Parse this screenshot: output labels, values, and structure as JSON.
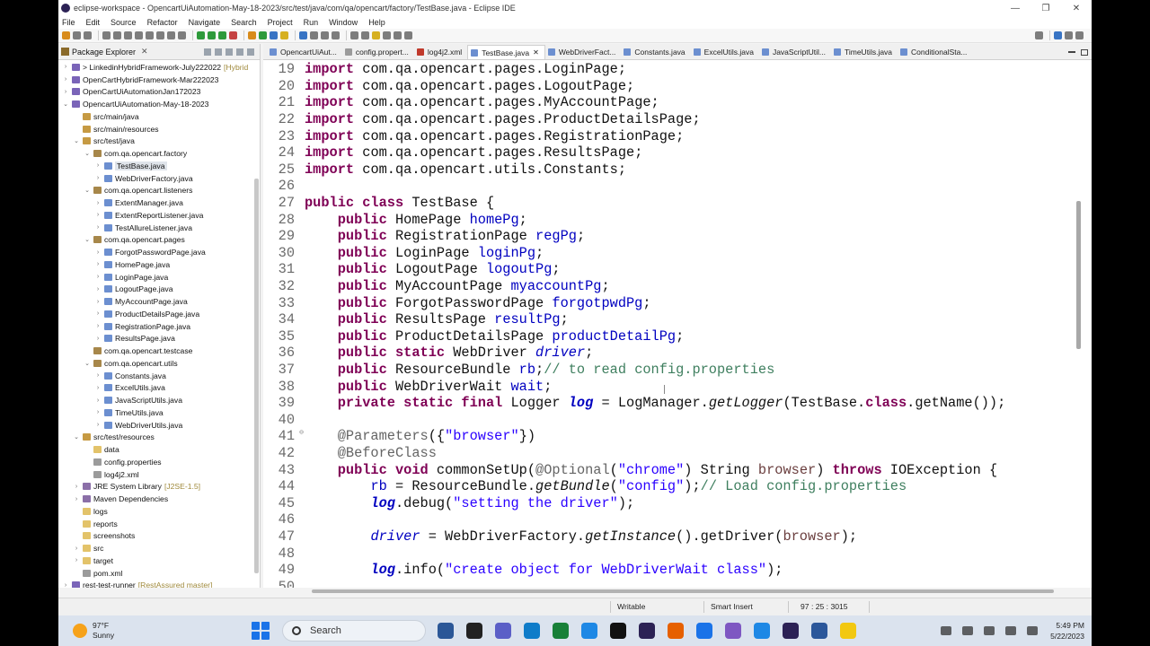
{
  "window": {
    "title": "eclipse-workspace - OpencartUiAutomation-May-18-2023/src/test/java/com/qa/opencart/factory/TestBase.java - Eclipse IDE",
    "buttons": {
      "minimize": "—",
      "maximize": "❐",
      "close": "✕"
    }
  },
  "menu": [
    "File",
    "Edit",
    "Source",
    "Refactor",
    "Navigate",
    "Search",
    "Project",
    "Run",
    "Window",
    "Help"
  ],
  "explorer": {
    "title": "Package Explorer",
    "rows": [
      {
        "label": "> LinkedinHybridFramework-July222022",
        "deco": "[Hybrid",
        "level": 0,
        "icon": "proj",
        "tw": "›"
      },
      {
        "label": "OpenCartHybridFramework-Mar222023",
        "deco": "",
        "level": 0,
        "icon": "proj",
        "tw": "›"
      },
      {
        "label": "OpenCartUiAutomationJan172023",
        "deco": "",
        "level": 0,
        "icon": "proj",
        "tw": "›"
      },
      {
        "label": "OpencartUiAutomation-May-18-2023",
        "deco": "",
        "level": 0,
        "icon": "proj",
        "tw": "⌄"
      },
      {
        "label": "src/main/java",
        "deco": "",
        "level": 1,
        "icon": "src",
        "tw": ""
      },
      {
        "label": "src/main/resources",
        "deco": "",
        "level": 1,
        "icon": "src",
        "tw": ""
      },
      {
        "label": "src/test/java",
        "deco": "",
        "level": 1,
        "icon": "src",
        "tw": "⌄"
      },
      {
        "label": "com.qa.opencart.factory",
        "deco": "",
        "level": 2,
        "icon": "pkg",
        "tw": "⌄"
      },
      {
        "label": "TestBase.java",
        "deco": "",
        "level": 3,
        "icon": "java",
        "tw": "›",
        "sel": true
      },
      {
        "label": "WebDriverFactory.java",
        "deco": "",
        "level": 3,
        "icon": "java",
        "tw": "›"
      },
      {
        "label": "com.qa.opencart.listeners",
        "deco": "",
        "level": 2,
        "icon": "pkg",
        "tw": "⌄"
      },
      {
        "label": "ExtentManager.java",
        "deco": "",
        "level": 3,
        "icon": "java",
        "tw": "›"
      },
      {
        "label": "ExtentReportListener.java",
        "deco": "",
        "level": 3,
        "icon": "java",
        "tw": "›"
      },
      {
        "label": "TestAllureListener.java",
        "deco": "",
        "level": 3,
        "icon": "java",
        "tw": "›"
      },
      {
        "label": "com.qa.opencart.pages",
        "deco": "",
        "level": 2,
        "icon": "pkg",
        "tw": "⌄"
      },
      {
        "label": "ForgotPasswordPage.java",
        "deco": "",
        "level": 3,
        "icon": "java",
        "tw": "›"
      },
      {
        "label": "HomePage.java",
        "deco": "",
        "level": 3,
        "icon": "java",
        "tw": "›"
      },
      {
        "label": "LoginPage.java",
        "deco": "",
        "level": 3,
        "icon": "java",
        "tw": "›"
      },
      {
        "label": "LogoutPage.java",
        "deco": "",
        "level": 3,
        "icon": "java",
        "tw": "›"
      },
      {
        "label": "MyAccountPage.java",
        "deco": "",
        "level": 3,
        "icon": "java",
        "tw": "›"
      },
      {
        "label": "ProductDetailsPage.java",
        "deco": "",
        "level": 3,
        "icon": "java",
        "tw": "›"
      },
      {
        "label": "RegistrationPage.java",
        "deco": "",
        "level": 3,
        "icon": "java",
        "tw": "›"
      },
      {
        "label": "ResultsPage.java",
        "deco": "",
        "level": 3,
        "icon": "java",
        "tw": "›"
      },
      {
        "label": "com.qa.opencart.testcase",
        "deco": "",
        "level": 2,
        "icon": "pkg",
        "tw": ""
      },
      {
        "label": "com.qa.opencart.utils",
        "deco": "",
        "level": 2,
        "icon": "pkg",
        "tw": "⌄"
      },
      {
        "label": "Constants.java",
        "deco": "",
        "level": 3,
        "icon": "java",
        "tw": "›"
      },
      {
        "label": "ExcelUtils.java",
        "deco": "",
        "level": 3,
        "icon": "java",
        "tw": "›"
      },
      {
        "label": "JavaScriptUtils.java",
        "deco": "",
        "level": 3,
        "icon": "java",
        "tw": "›"
      },
      {
        "label": "TimeUtils.java",
        "deco": "",
        "level": 3,
        "icon": "java",
        "tw": "›"
      },
      {
        "label": "WebDriverUtils.java",
        "deco": "",
        "level": 3,
        "icon": "java",
        "tw": "›"
      },
      {
        "label": "src/test/resources",
        "deco": "",
        "level": 1,
        "icon": "src",
        "tw": "⌄"
      },
      {
        "label": "data",
        "deco": "",
        "level": 2,
        "icon": "folder",
        "tw": ""
      },
      {
        "label": "config.properties",
        "deco": "",
        "level": 2,
        "icon": "file",
        "tw": ""
      },
      {
        "label": "log4j2.xml",
        "deco": "",
        "level": 2,
        "icon": "file",
        "tw": ""
      },
      {
        "label": "JRE System Library",
        "deco": "[J2SE-1.5]",
        "level": 1,
        "icon": "lib",
        "tw": "›"
      },
      {
        "label": "Maven Dependencies",
        "deco": "",
        "level": 1,
        "icon": "lib",
        "tw": "›"
      },
      {
        "label": "logs",
        "deco": "",
        "level": 1,
        "icon": "folder",
        "tw": ""
      },
      {
        "label": "reports",
        "deco": "",
        "level": 1,
        "icon": "folder",
        "tw": ""
      },
      {
        "label": "screenshots",
        "deco": "",
        "level": 1,
        "icon": "folder",
        "tw": ""
      },
      {
        "label": "src",
        "deco": "",
        "level": 1,
        "icon": "folder",
        "tw": "›"
      },
      {
        "label": "target",
        "deco": "",
        "level": 1,
        "icon": "folder",
        "tw": "›"
      },
      {
        "label": "pom.xml",
        "deco": "",
        "level": 1,
        "icon": "file",
        "tw": ""
      },
      {
        "label": "rest-test-runner",
        "deco": "[RestAssured master]",
        "level": 0,
        "icon": "proj",
        "tw": "›"
      }
    ]
  },
  "tabs": [
    {
      "label": "OpencartUiAut...",
      "icon": "j",
      "active": false
    },
    {
      "label": "config.propert...",
      "icon": "f",
      "active": false
    },
    {
      "label": "log4j2.xml",
      "icon": "x",
      "active": false
    },
    {
      "label": "TestBase.java",
      "icon": "j",
      "active": true
    },
    {
      "label": "WebDriverFact...",
      "icon": "j",
      "active": false
    },
    {
      "label": "Constants.java",
      "icon": "j",
      "active": false
    },
    {
      "label": "ExcelUtils.java",
      "icon": "j",
      "active": false
    },
    {
      "label": "JavaScriptUtil...",
      "icon": "j",
      "active": false
    },
    {
      "label": "TimeUtils.java",
      "icon": "j",
      "active": false
    },
    {
      "label": "ConditionalSta...",
      "icon": "j",
      "active": false
    }
  ],
  "code": [
    {
      "n": "19",
      "t": [
        [
          "kw",
          "import"
        ],
        [
          "",
          "com.qa.opencart.pages.LoginPage;"
        ]
      ]
    },
    {
      "n": "20",
      "t": [
        [
          "kw",
          "import"
        ],
        [
          "",
          "com.qa.opencart.pages.LogoutPage;"
        ]
      ]
    },
    {
      "n": "21",
      "t": [
        [
          "kw",
          "import"
        ],
        [
          "",
          "com.qa.opencart.pages.MyAccountPage;"
        ]
      ]
    },
    {
      "n": "22",
      "t": [
        [
          "kw",
          "import"
        ],
        [
          "",
          "com.qa.opencart.pages.ProductDetailsPage;"
        ]
      ]
    },
    {
      "n": "23",
      "t": [
        [
          "kw",
          "import"
        ],
        [
          "",
          "com.qa.opencart.pages.RegistrationPage;"
        ]
      ]
    },
    {
      "n": "24",
      "t": [
        [
          "kw",
          "import"
        ],
        [
          "",
          "com.qa.opencart.pages.ResultsPage;"
        ]
      ]
    },
    {
      "n": "25",
      "t": [
        [
          "kw",
          "import"
        ],
        [
          "",
          "com.qa.opencart.utils.Constants;"
        ]
      ]
    },
    {
      "n": "26",
      "t": []
    },
    {
      "n": "27",
      "t": [
        [
          "kw",
          "public class"
        ],
        [
          "",
          " TestBase {"
        ]
      ]
    },
    {
      "n": "28",
      "t": [
        [
          "",
          "    "
        ],
        [
          "kw",
          "public"
        ],
        [
          "",
          " HomePage "
        ],
        [
          "fld",
          "homePg"
        ],
        [
          "",
          ";"
        ]
      ]
    },
    {
      "n": "29",
      "t": [
        [
          "",
          "    "
        ],
        [
          "kw",
          "public"
        ],
        [
          "",
          " RegistrationPage "
        ],
        [
          "fld",
          "regPg"
        ],
        [
          "",
          ";"
        ]
      ]
    },
    {
      "n": "30",
      "t": [
        [
          "",
          "    "
        ],
        [
          "kw",
          "public"
        ],
        [
          "",
          " LoginPage "
        ],
        [
          "fld",
          "loginPg"
        ],
        [
          "",
          ";"
        ]
      ]
    },
    {
      "n": "31",
      "t": [
        [
          "",
          "    "
        ],
        [
          "kw",
          "public"
        ],
        [
          "",
          " LogoutPage "
        ],
        [
          "fld",
          "logoutPg"
        ],
        [
          "",
          ";"
        ]
      ]
    },
    {
      "n": "32",
      "t": [
        [
          "",
          "    "
        ],
        [
          "kw",
          "public"
        ],
        [
          "",
          " MyAccountPage "
        ],
        [
          "fld",
          "myaccountPg"
        ],
        [
          "",
          ";"
        ]
      ]
    },
    {
      "n": "33",
      "t": [
        [
          "",
          "    "
        ],
        [
          "kw",
          "public"
        ],
        [
          "",
          " ForgotPasswordPage "
        ],
        [
          "fld",
          "forgotpwdPg"
        ],
        [
          "",
          ";"
        ]
      ]
    },
    {
      "n": "34",
      "t": [
        [
          "",
          "    "
        ],
        [
          "kw",
          "public"
        ],
        [
          "",
          " ResultsPage "
        ],
        [
          "fld",
          "resultPg"
        ],
        [
          "",
          ";"
        ]
      ]
    },
    {
      "n": "35",
      "t": [
        [
          "",
          "    "
        ],
        [
          "kw",
          "public"
        ],
        [
          "",
          " ProductDetailsPage "
        ],
        [
          "fld",
          "productDetailPg"
        ],
        [
          "",
          ";"
        ]
      ]
    },
    {
      "n": "36",
      "t": [
        [
          "",
          "    "
        ],
        [
          "kw",
          "public static"
        ],
        [
          "",
          " WebDriver "
        ],
        [
          "fldi",
          "driver"
        ],
        [
          "",
          ";"
        ]
      ]
    },
    {
      "n": "37",
      "t": [
        [
          "",
          "    "
        ],
        [
          "kw",
          "public"
        ],
        [
          "",
          " ResourceBundle "
        ],
        [
          "fld",
          "rb"
        ],
        [
          "",
          ";"
        ],
        [
          "cm",
          "// to read config.properties"
        ]
      ]
    },
    {
      "n": "38",
      "t": [
        [
          "",
          "    "
        ],
        [
          "kw",
          "public"
        ],
        [
          "",
          " WebDriverWait "
        ],
        [
          "fld",
          "wait"
        ],
        [
          "",
          ";"
        ]
      ]
    },
    {
      "n": "39",
      "t": [
        [
          "",
          "    "
        ],
        [
          "kw",
          "private static final"
        ],
        [
          "",
          " Logger "
        ],
        [
          "sf",
          "log"
        ],
        [
          "",
          " = LogManager."
        ],
        [
          "it",
          "getLogger"
        ],
        [
          "",
          "(TestBase."
        ],
        [
          "kw",
          "class"
        ],
        [
          "",
          ".getName());"
        ]
      ]
    },
    {
      "n": "40",
      "t": []
    },
    {
      "n": "41",
      "fold": true,
      "t": [
        [
          "",
          "    "
        ],
        [
          "an",
          "@Parameters"
        ],
        [
          "",
          "({"
        ],
        [
          "str",
          "\"browser\""
        ],
        [
          "",
          "})"
        ]
      ]
    },
    {
      "n": "42",
      "t": [
        [
          "",
          "    "
        ],
        [
          "an",
          "@BeforeClass"
        ]
      ]
    },
    {
      "n": "43",
      "t": [
        [
          "",
          "    "
        ],
        [
          "kw",
          "public void"
        ],
        [
          "",
          " commonSetUp("
        ],
        [
          "an",
          "@Optional"
        ],
        [
          "",
          "("
        ],
        [
          "str",
          "\"chrome\""
        ],
        [
          "",
          ") String "
        ],
        [
          "var",
          "browser"
        ],
        [
          "",
          ") "
        ],
        [
          "kw",
          "throws"
        ],
        [
          "",
          " IOException {"
        ]
      ]
    },
    {
      "n": "44",
      "t": [
        [
          "",
          "        "
        ],
        [
          "fld",
          "rb"
        ],
        [
          "",
          " = ResourceBundle."
        ],
        [
          "it",
          "getBundle"
        ],
        [
          "",
          "("
        ],
        [
          "str",
          "\"config\""
        ],
        [
          "",
          ");"
        ],
        [
          "cm",
          "// Load config.properties"
        ]
      ]
    },
    {
      "n": "45",
      "t": [
        [
          "",
          "        "
        ],
        [
          "sf",
          "log"
        ],
        [
          "",
          ".debug("
        ],
        [
          "str",
          "\"setting the driver\""
        ],
        [
          "",
          ");"
        ]
      ]
    },
    {
      "n": "46",
      "t": []
    },
    {
      "n": "47",
      "t": [
        [
          "",
          "        "
        ],
        [
          "fldi",
          "driver"
        ],
        [
          "",
          " = WebDriverFactory."
        ],
        [
          "it",
          "getInstance"
        ],
        [
          "",
          "().getDriver("
        ],
        [
          "var",
          "browser"
        ],
        [
          "",
          ");"
        ]
      ]
    },
    {
      "n": "48",
      "t": []
    },
    {
      "n": "49",
      "t": [
        [
          "",
          "        "
        ],
        [
          "sf",
          "log"
        ],
        [
          "",
          ".info("
        ],
        [
          "str",
          "\"create object for WebDriverWait class\""
        ],
        [
          "",
          ");"
        ]
      ]
    },
    {
      "n": "50",
      "t": []
    }
  ],
  "status": {
    "writable": "Writable",
    "insert": "Smart Insert",
    "position": "97 : 25 : 3015"
  },
  "taskbar": {
    "temp": "97°F",
    "weather": "Sunny",
    "search": "Search",
    "time": "5:49 PM",
    "date": "5/22/2023",
    "app_colors": [
      "#2b5797",
      "#222",
      "#5b5fc7",
      "#0f7cc9",
      "#188038",
      "#1e88e5",
      "#111",
      "#2c2255",
      "#e66000",
      "#1a73e8",
      "#7e57c2",
      "#1e88e5",
      "#2c2255",
      "#2b579a",
      "#f2c811"
    ]
  }
}
